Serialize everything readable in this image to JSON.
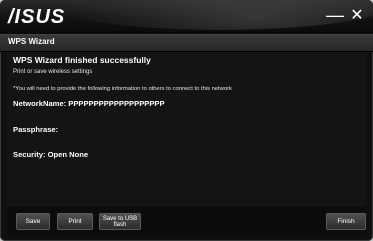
{
  "window": {
    "logo": "/ISUS",
    "minimize_label": "—",
    "close_label": "✕"
  },
  "header": {
    "title": "WPS Wizard"
  },
  "content": {
    "headline": "WPS Wizard finished successfully",
    "subline": "Print or save wireless settings",
    "note": "*You will need to provide the following information to others to connect to this network",
    "network_name": "NetworkName: PPPPPPPPPPPPPPPPPPP",
    "passphrase": "Passphrase:",
    "security": "Security: Open None"
  },
  "buttons": {
    "save": "Save",
    "print": "Print",
    "usb_line1": "Save to USB",
    "usb_line2": "flash",
    "finish": "Finish"
  }
}
